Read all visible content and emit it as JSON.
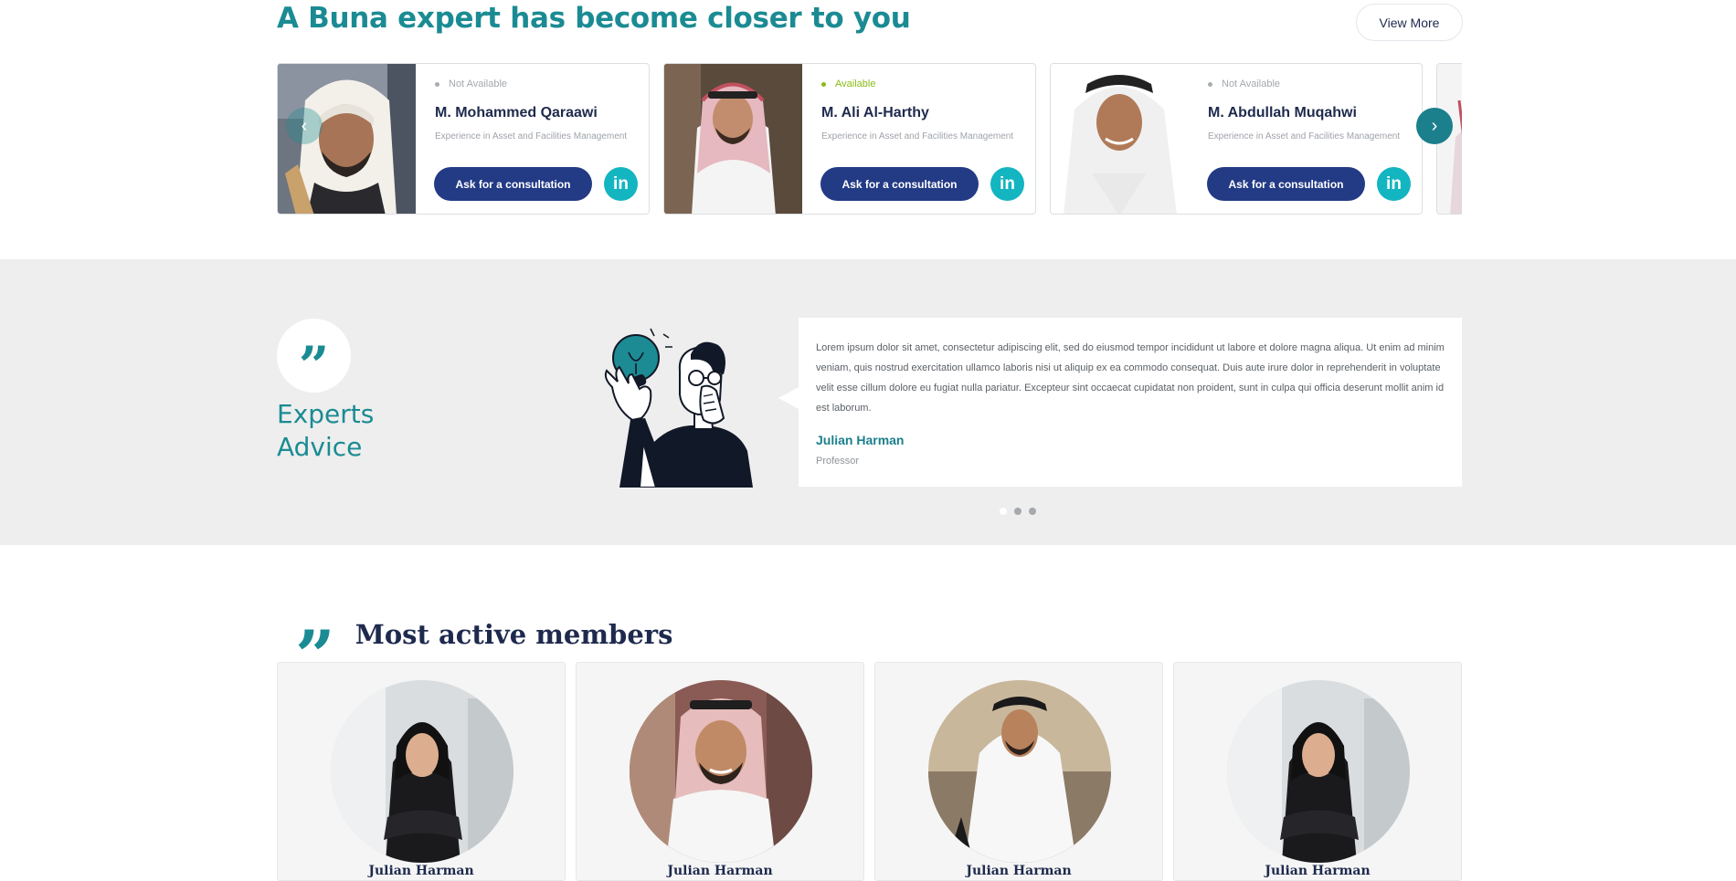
{
  "experts": {
    "title": "A Buna expert has become closer to you",
    "view_more": "View More",
    "cards": [
      {
        "status": "Not Available",
        "available": false,
        "name": "M. Mohammed Qaraawi",
        "experience": "Experience in Asset and Facilities Management",
        "cta": "Ask for a consultation",
        "linkedin": "in"
      },
      {
        "status": "Available",
        "available": true,
        "name": "M. Ali Al-Harthy",
        "experience": "Experience in Asset and Facilities Management",
        "cta": "Ask for a consultation",
        "linkedin": "in"
      },
      {
        "status": "Not Available",
        "available": false,
        "name": "M. Abdullah Muqahwi",
        "experience": "Experience in Asset and Facilities Management",
        "cta": "Ask for a consultation",
        "linkedin": "in"
      }
    ],
    "prev_icon": "chevron-left-icon",
    "next_icon": "chevron-right-icon"
  },
  "advice": {
    "title_line1": "Experts",
    "title_line2": "Advice",
    "quote_text": "Lorem ipsum dolor sit amet, consectetur adipiscing elit, sed do eiusmod tempor incididunt ut labore et dolore magna aliqua. Ut enim ad minim veniam, quis nostrud exercitation ullamco laboris nisi ut aliquip ex ea commodo consequat. Duis aute irure dolor in reprehenderit in voluptate velit esse cillum dolore eu fugiat nulla pariatur. Excepteur sint occaecat cupidatat non proident, sunt in culpa qui officia deserunt mollit anim id est laborum.",
    "author": "Julian Harman",
    "role": "Professor",
    "slides": 3,
    "active_slide": 1
  },
  "members": {
    "title": "Most active members",
    "items": [
      {
        "name": "Julian Harman"
      },
      {
        "name": "Julian Harman"
      },
      {
        "name": "Julian Harman"
      },
      {
        "name": "Julian Harman"
      }
    ]
  },
  "colors": {
    "teal": "#1b8b93",
    "navy": "#233a85",
    "linkedin": "#13b5c1",
    "available": "#8bbb17",
    "section_bg": "#eeeeee"
  }
}
